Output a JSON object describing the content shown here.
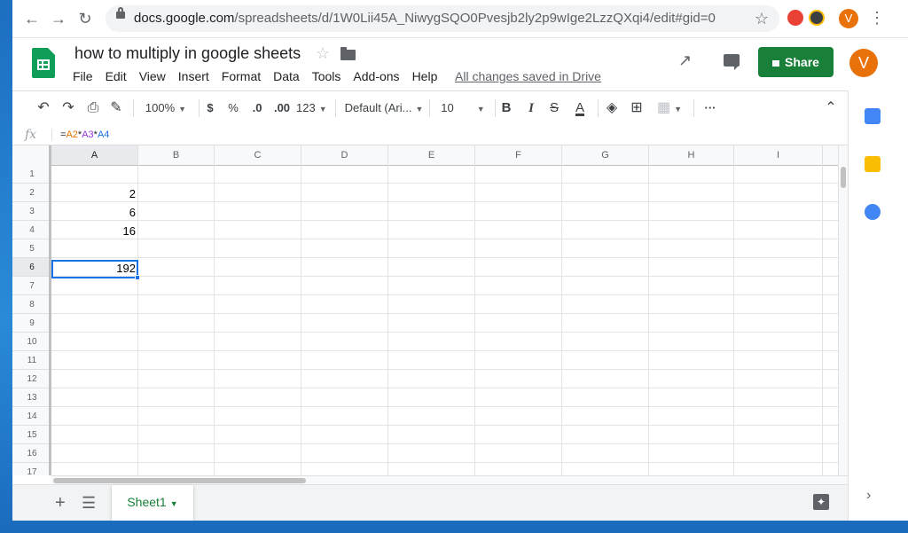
{
  "browser": {
    "url_host": "docs.google.com",
    "url_path": "/spreadsheets/d/1W0Lii45A_NiwygSQO0Pvesjb2ly2p9wIge2LzzQXqi4/edit#gid=0",
    "profile_initial": "V"
  },
  "header": {
    "title": "how to multiply in google sheets",
    "menu": [
      "File",
      "Edit",
      "View",
      "Insert",
      "Format",
      "Data",
      "Tools",
      "Add-ons",
      "Help"
    ],
    "save_status": "All changes saved in Drive",
    "share_label": "Share",
    "avatar_initial": "V"
  },
  "toolbar": {
    "zoom": "100%",
    "currency": "$",
    "percent": "%",
    "decrease_decimal": ".0",
    "increase_decimal": ".00",
    "more_formats": "123",
    "font": "Default (Ari...",
    "font_size": "10",
    "bold": "B",
    "italic": "I",
    "strikethrough": "S",
    "text_color": "A",
    "more": "···"
  },
  "formula_bar": {
    "fx": "fx",
    "parts": [
      "=",
      "A2",
      "*",
      "A3",
      "*",
      "A4"
    ]
  },
  "grid": {
    "columns": [
      "A",
      "B",
      "C",
      "D",
      "E",
      "F",
      "G",
      "H",
      "I"
    ],
    "rows": [
      "1",
      "2",
      "3",
      "4",
      "5",
      "6",
      "7",
      "8",
      "9",
      "10",
      "11",
      "12",
      "13",
      "14",
      "15",
      "16",
      "17"
    ],
    "selected_column": "A",
    "selected_row": "6",
    "cells": {
      "A2": "2",
      "A3": "6",
      "A4": "16",
      "A6": "192"
    }
  },
  "sheets": {
    "active_tab": "Sheet1"
  },
  "colors": {
    "brand_green": "#188038",
    "selection_blue": "#1a73e8",
    "avatar_orange": "#e8710a",
    "formula_ref_orange": "#e37400",
    "formula_ref_purple": "#9334e6",
    "formula_ref_blue": "#1a73e8"
  },
  "side_panel": {
    "icons": [
      "calendar-icon",
      "keep-icon",
      "tasks-icon"
    ]
  }
}
